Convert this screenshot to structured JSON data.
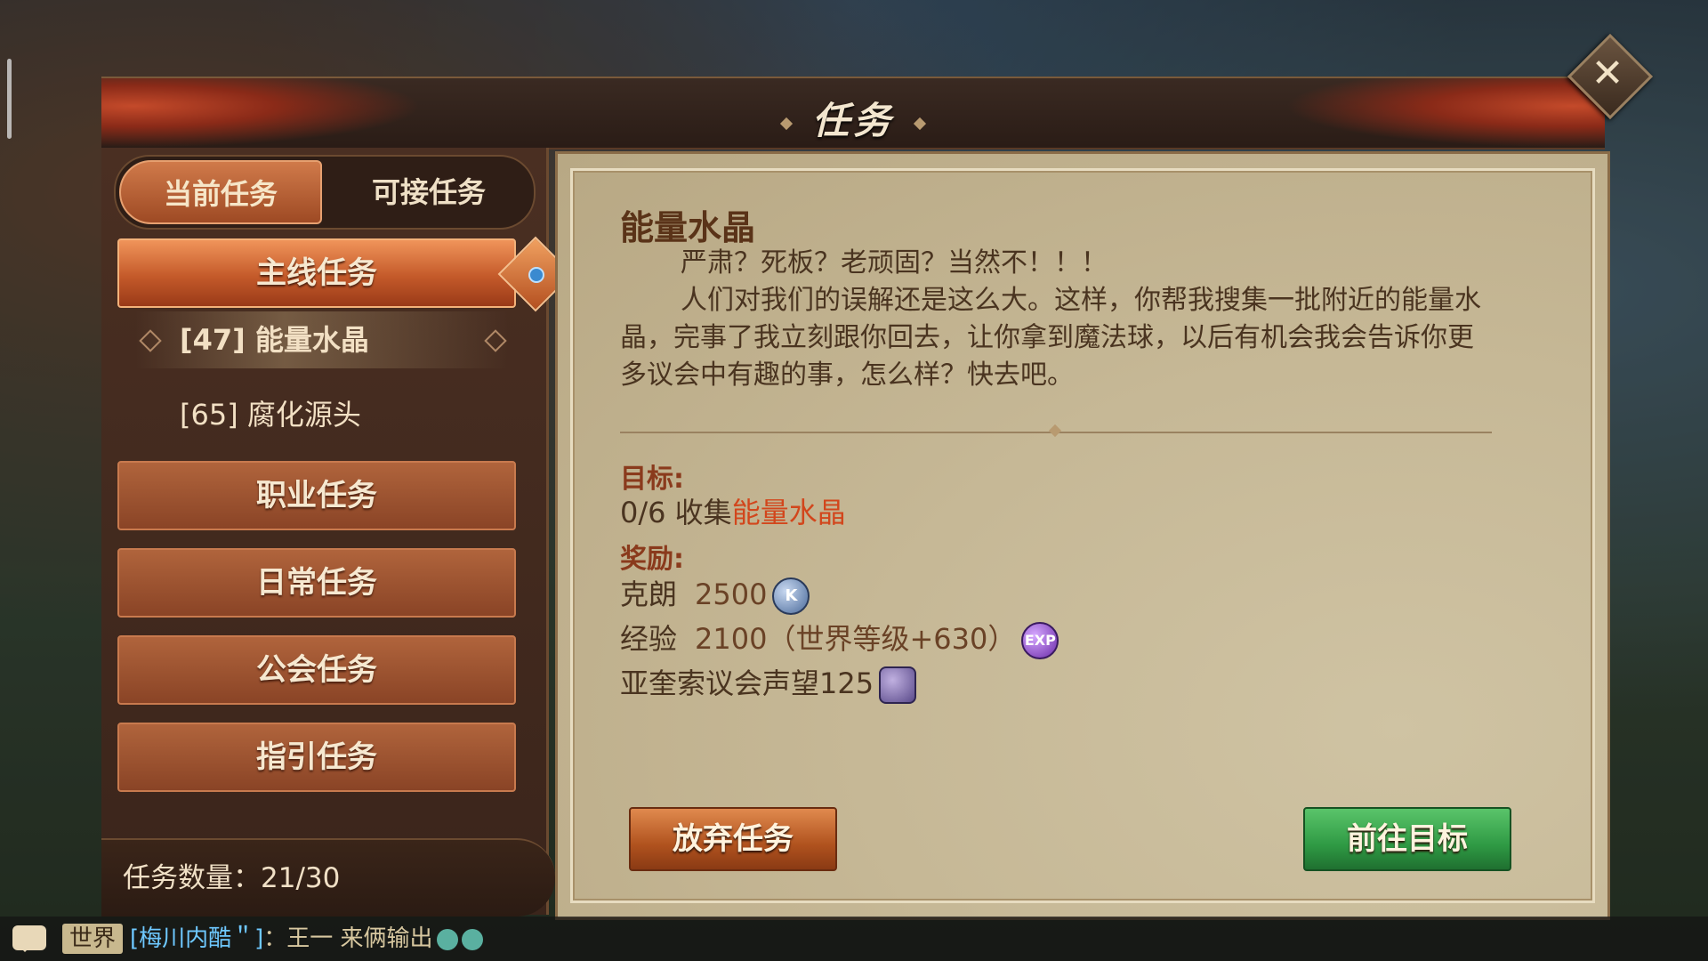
{
  "window": {
    "title": "任务",
    "close_icon": "close-icon"
  },
  "tabs": [
    {
      "label": "当前任务",
      "active": true
    },
    {
      "label": "可接任务",
      "active": false
    }
  ],
  "categories": [
    {
      "label": "主线任务",
      "active": true
    },
    {
      "label": "职业任务"
    },
    {
      "label": "日常任务"
    },
    {
      "label": "公会任务"
    },
    {
      "label": "指引任务"
    }
  ],
  "quests": [
    {
      "label": "[47] 能量水晶",
      "selected": true
    },
    {
      "label": "[65] 腐化源头",
      "selected": false
    }
  ],
  "quest_count": "任务数量：21/30",
  "detail": {
    "title": "能量水晶",
    "description": [
      "严肃？死板？老顽固？当然不！！！",
      "人们对我们的误解还是这么大。这样，你帮我搜集一批附近的能量水晶，完事了我立刻跟你回去，让你拿到魔法球，以后有机会我会告诉你更多议会中有趣的事，怎么样？快去吧。"
    ],
    "objective_label": "目标:",
    "objective_prefix": "0/6 收集",
    "objective_target": "能量水晶",
    "reward_label": "奖励:",
    "rewards": [
      {
        "name": "克朗",
        "value": "2500",
        "icon": "krona-coin-icon",
        "icon_text": "K"
      },
      {
        "name": "经验",
        "value": "2100（世界等级+630）",
        "icon": "exp-icon",
        "icon_text": "EXP"
      },
      {
        "name": "亚奎索议会声望",
        "value": "125",
        "icon": "reputation-icon",
        "icon_text": ""
      }
    ]
  },
  "buttons": {
    "abandon": "放弃任务",
    "goto": "前往目标"
  },
  "chat": {
    "channel": "世界",
    "name": "[梅川内酷＂]",
    "message": "：王一 来俩输出"
  },
  "colors": {
    "accent_orange": "#d2461c",
    "button_green": "#2f9a44",
    "button_orange": "#b0521e"
  }
}
